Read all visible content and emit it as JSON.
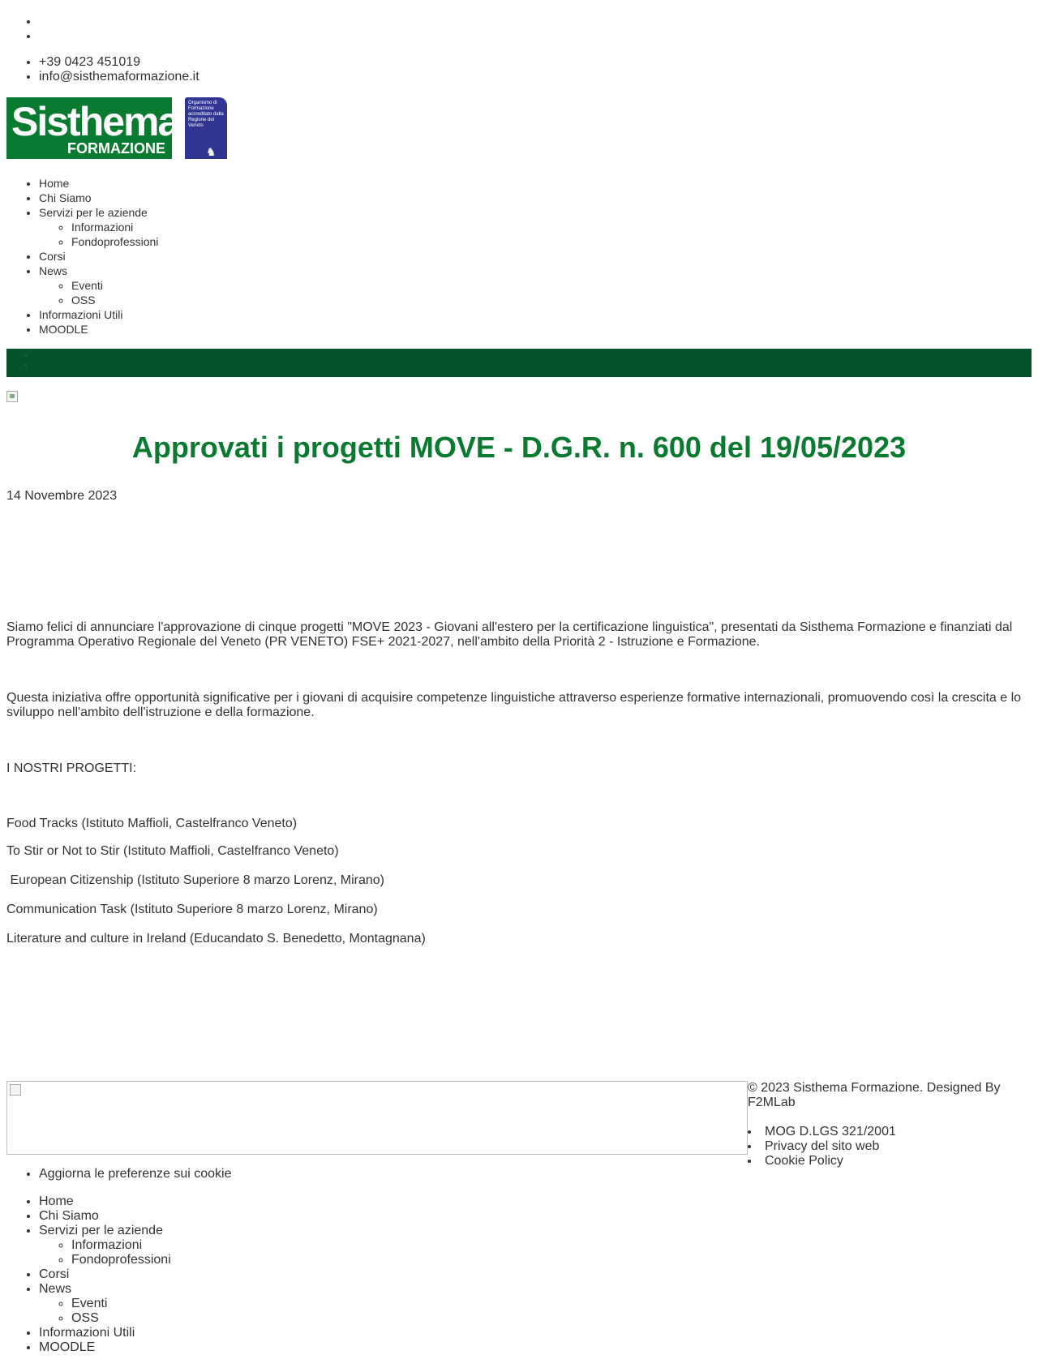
{
  "contact": {
    "phone": "+39 0423 451019",
    "email": "info@sisthemaformazione.it"
  },
  "logo": {
    "main": "Sisthema",
    "sub": "FORMAZIONE"
  },
  "badge": {
    "text": "Organismo di Formazione accreditato dalla Regione del Veneto"
  },
  "nav": {
    "home": "Home",
    "chi_siamo": "Chi Siamo",
    "servizi": "Servizi per le aziende",
    "servizi_sub": [
      "Informazioni",
      "Fondoprofessioni"
    ],
    "corsi": "Corsi",
    "news": "News",
    "news_sub": [
      "Eventi",
      "OSS"
    ],
    "informazioni_utili": "Informazioni Utili",
    "moodle": "MOODLE"
  },
  "article": {
    "title": "Approvati i progetti MOVE - D.G.R. n. 600 del 19/05/2023",
    "date": "14 Novembre 2023",
    "paragraphs": [
      "Siamo felici di annunciare l'approvazione di cinque progetti \"MOVE 2023 - Giovani all'estero per la certificazione linguistica\", presentati da Sisthema Formazione e finanziati dal Programma Operativo Regionale del Veneto (PR VENETO) FSE+ 2021-2027, nell'ambito della Priorità 2 - Istruzione e Formazione.",
      "Questa iniziativa offre opportunità significative per i giovani di acquisire competenze linguistiche attraverso esperienze formative internazionali, promuovendo così la crescita e lo sviluppo nell'ambito dell'istruzione e della formazione.",
      "I NOSTRI PROGETTI:"
    ],
    "projects": [
      "Food Tracks (Istituto Maffioli, Castelfranco Veneto)",
      "To Stir or Not to Stir (Istituto Maffioli, Castelfranco Veneto)",
      " European Citizenship (Istituto Superiore 8 marzo Lorenz, Mirano)",
      "Communication Task (Istituto Superiore 8 marzo Lorenz, Mirano)",
      "Literature and culture in Ireland (Educandato S. Benedetto, Montagnana)"
    ]
  },
  "footer": {
    "copyright": "© 2023 Sisthema Formazione. Designed By F2MLab",
    "links": [
      "MOG D.LGS 321/2001",
      "Privacy del sito web",
      "Cookie Policy"
    ],
    "cookie_prefs": "Aggiorna le preferenze sui cookie"
  },
  "colors": {
    "brand_green": "#0a7a31",
    "dark_green_bar": "#04532b",
    "badge_blue": "#2f3590",
    "text": "#333333"
  }
}
